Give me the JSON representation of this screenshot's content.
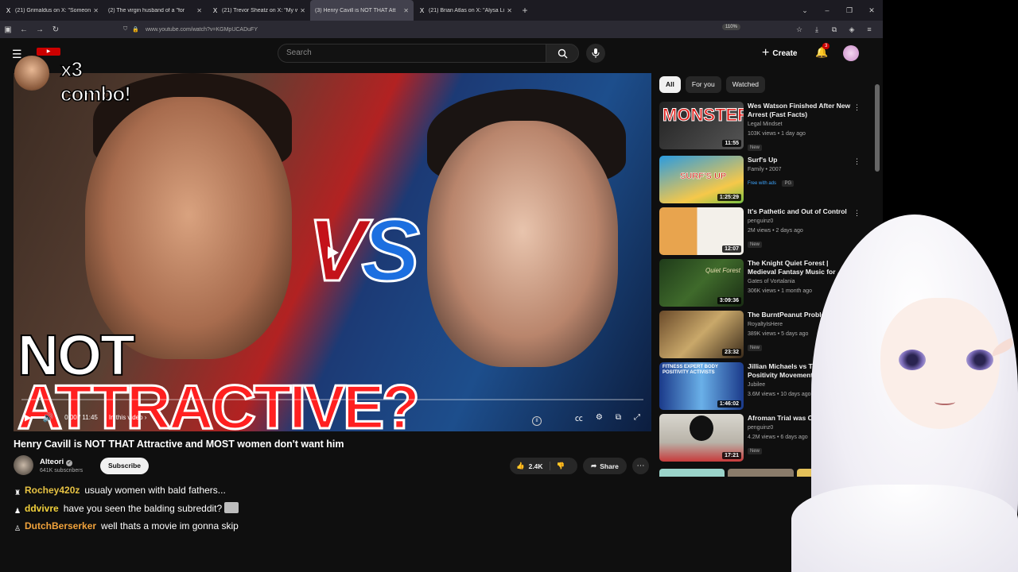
{
  "browser": {
    "tabs": [
      {
        "icon": "X",
        "title": "(21) Grimaldus on X: \"Someon"
      },
      {
        "icon": "▶",
        "title": "(2) The virgin husband of a \"for"
      },
      {
        "icon": "X",
        "title": "(21) Trevor Sheatz on X: \"My wi"
      },
      {
        "icon": "▶",
        "title": "(3) Henry Cavill is NOT THAT Att"
      },
      {
        "icon": "X",
        "title": "(21) Brian Atlas on X: \"Alysa Liu"
      }
    ],
    "active_tab": 3,
    "url": "www.youtube.com/watch?v=KGMpUCADuFY",
    "zoom": "110%"
  },
  "youtube": {
    "search_placeholder": "Search",
    "create_label": "Create",
    "notification_count": "3",
    "video": {
      "title": "Henry Cavill is NOT THAT Attractive and MOST women don't want him",
      "time": "0:00 / 11:45",
      "chapter": "In this video",
      "thumb_line1": "NOT",
      "thumb_line2": "ATTRACTIVE?",
      "thumb_vs_v": "V",
      "thumb_vs_s": "S",
      "progress": 0.0
    },
    "channel": {
      "name": "Alteori",
      "subscribers": "641K subscribers",
      "subscribe_label": "Subscribe"
    },
    "actions": {
      "likes": "2.4K",
      "share_label": "Share"
    },
    "chips": [
      "All",
      "For you",
      "Watched"
    ],
    "recommendations": [
      {
        "title": "Wes Watson Finished After New Arrest (Fast Facts)",
        "channel": "Legal Mindset",
        "meta": "103K views • 1 day ago",
        "duration": "11:55",
        "tag": "New",
        "thumb_text": "MONSTER"
      },
      {
        "title": "Surf's Up",
        "channel": "Family • 2007",
        "meta": "",
        "duration": "1:25:29",
        "tag": "Free with ads",
        "tag2": "PG",
        "thumb_text": "SURF'S UP"
      },
      {
        "title": "It's Pathetic and Out of Control",
        "channel": "penguinz0",
        "meta": "2M views • 2 days ago",
        "duration": "12:07",
        "tag": "New",
        "thumb_text": ""
      },
      {
        "title": "The Knight Quiet Forest | Medieval Fantasy Music for ...",
        "channel": "Gates of Vortalania",
        "meta": "306K views • 1 month ago",
        "duration": "3:09:36",
        "tag": "",
        "thumb_text": "Quiet Forest"
      },
      {
        "title": "The BurntPeanut Problem",
        "channel": "RoyaltyIsHere",
        "meta": "389K views • 5 days ago",
        "duration": "23:32",
        "tag": "New",
        "thumb_text": ""
      },
      {
        "title": "Jillian Michaels vs The Body Positivity Movement |",
        "channel": "Jubilee",
        "meta": "3.6M views • 10 days ago",
        "duration": "1:46:02",
        "tag": "",
        "thumb_text": "FITNESS EXPERT  BODY POSITIVITY ACTIVISTS"
      },
      {
        "title": "Afroman Trial was Crazy",
        "channel": "penguinz0",
        "meta": "4.2M views • 6 days ago",
        "duration": "17:21",
        "tag": "New",
        "thumb_text": ""
      }
    ]
  },
  "stream": {
    "combo_text": "x3 combo!",
    "chat": [
      {
        "user": "Rochey420z",
        "color": "#e6c243",
        "badge": "♜",
        "message": "usualy women with bald fathers...",
        "emote": false
      },
      {
        "user": "ddvivre",
        "color": "#f2d13b",
        "badge": "♟",
        "message": "have you seen the balding subreddit?",
        "emote": true
      },
      {
        "user": "DutchBerserker",
        "color": "#f0a23b",
        "badge": "♙",
        "message": "well thats a movie im gonna skip",
        "emote": false
      }
    ]
  }
}
